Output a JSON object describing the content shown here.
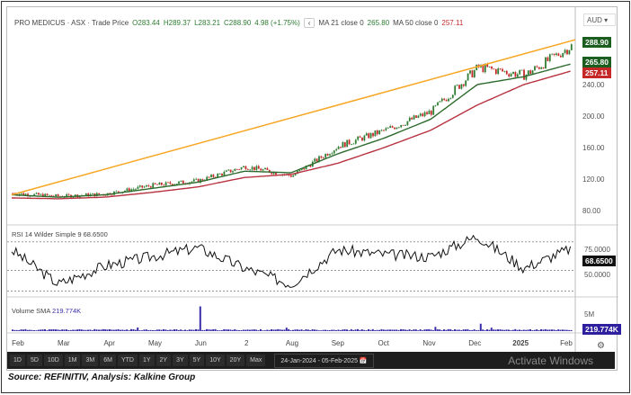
{
  "header": {
    "title": "PRO MEDICUS · ASX · Trade Price",
    "o": "O283.44",
    "h": "H289.37",
    "l": "L283.21",
    "c": "C288.90",
    "chg": "4.98 (+1.75%)",
    "nav": "‹",
    "ma21_label": "MA 21 close 0",
    "ma21_val": "265.80",
    "ma50_label": "MA 50 close 0",
    "ma50_val": "257.11"
  },
  "currency": "AUD ▾",
  "price_tags": {
    "last": "288.90",
    "ma21": "265.80",
    "ma50": "257.11"
  },
  "rsi": {
    "label": "RSI 14 Wilder Simple 9",
    "value": "68.6500",
    "tick75": "75.0000",
    "tick50": "50.0000"
  },
  "volume": {
    "label": "Volume SMA",
    "value": "219.774K",
    "tick": "5M"
  },
  "toolbar": {
    "buttons": [
      "1D",
      "5D",
      "10D",
      "1M",
      "3M",
      "6M",
      "YTD",
      "1Y",
      "2Y",
      "3Y",
      "5Y",
      "10Y",
      "20Y",
      "Max"
    ],
    "range": "24-Jan-2024 - 05-Feb-2025",
    "watermark": "Activate Windows"
  },
  "source": "Source: REFINITIV, Analysis: Kalkine Group",
  "colors": {
    "up": "#2e7d32",
    "down": "#c62828",
    "ma21": "#2e6b2e",
    "ma50": "#b83240",
    "trend": "#f5a623",
    "rsi": "#111111",
    "volume": "#3a2ea8"
  },
  "chart_data": {
    "type": "candlestick",
    "x_ticks": [
      "Feb",
      "Mar",
      "Apr",
      "May",
      "Jun",
      "2",
      "Aug",
      "Sep",
      "Oct",
      "Nov",
      "Dec",
      "2025",
      "Feb"
    ],
    "y_ticks": [
      80,
      120,
      160,
      200,
      240
    ],
    "ylim": [
      65,
      300
    ],
    "close_keypoints": [
      102,
      98,
      101,
      112,
      118,
      136,
      124,
      162,
      182,
      206,
      262,
      252,
      289
    ],
    "ma21_keypoints": [
      100,
      97,
      100,
      108,
      116,
      130,
      128,
      152,
      172,
      196,
      240,
      250,
      266
    ],
    "ma50_keypoints": [
      96,
      95,
      97,
      103,
      110,
      122,
      126,
      140,
      160,
      182,
      214,
      240,
      257
    ],
    "trendline": [
      100,
      297
    ],
    "rsi_keypoints": [
      68,
      38,
      54,
      62,
      70,
      52,
      38,
      68,
      64,
      62,
      80,
      52,
      69
    ],
    "rsi_ylim": [
      30,
      85
    ],
    "volume_spikes": {
      "Jun": 5,
      "Dec": 1.5
    }
  }
}
